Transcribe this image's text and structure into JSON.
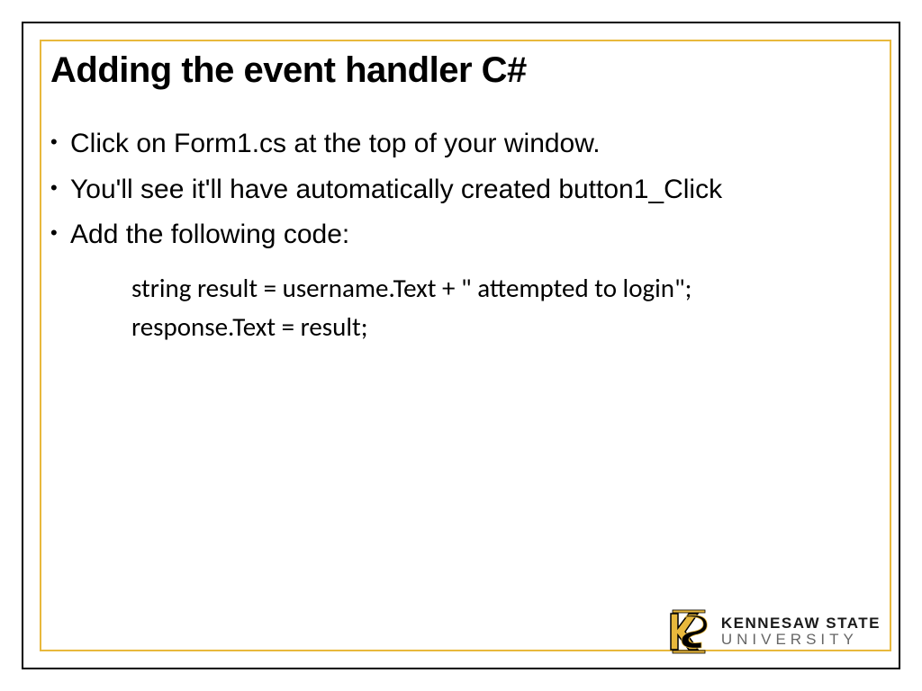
{
  "slide": {
    "title": "Adding the event handler C#",
    "bullets": [
      "Click on Form1.cs at the top of your window.",
      "You'll see it'll have automatically created button1_Click",
      "Add the following code:"
    ],
    "code": [
      "string result = username.Text + \" attempted to login\";",
      "response.Text = result;"
    ]
  },
  "logo": {
    "line1": "KENNESAW STATE",
    "line2": "UNIVERSITY"
  },
  "colors": {
    "accent_gold": "#e8b83c",
    "outer_border": "#000000"
  }
}
